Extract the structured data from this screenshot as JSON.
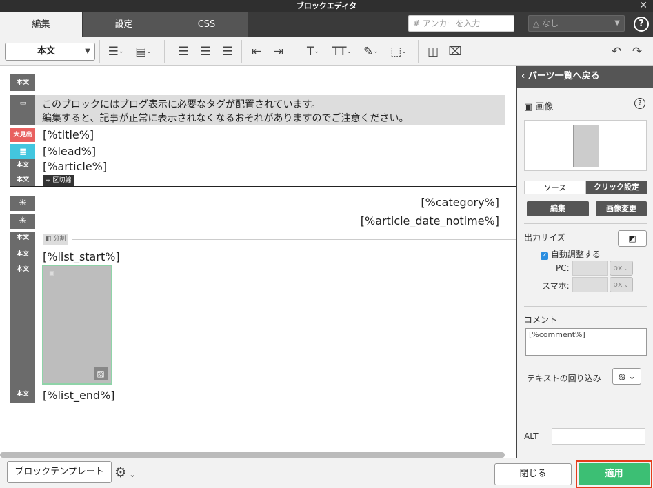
{
  "window": {
    "title": "ブロックエディタ",
    "close": "✕"
  },
  "tabs": [
    {
      "label": "編集"
    },
    {
      "label": "設定"
    },
    {
      "label": "CSS"
    }
  ],
  "anchor": {
    "placeholder": "# アンカーを入力"
  },
  "select_none": {
    "value": "なし"
  },
  "help": "?",
  "toolbar": {
    "format_value": "本文"
  },
  "editor": {
    "block_label": "本文",
    "heading_label": "大見出",
    "notice_line1": "このブロックにはブログ表示に必要なタグが配置されています。",
    "notice_line2": "編集すると、記事が正常に表示されなくなるおそれがありますのでご注意ください。",
    "title": "[%title%]",
    "lead": "[%lead%]",
    "article": "[%article%]",
    "divider_label": "区切線",
    "category": "[%category%]",
    "article_date": "[%article_date_notime%]",
    "split_label": "分割",
    "list_start": "[%list_start%]",
    "list_end": "[%list_end%]"
  },
  "panel": {
    "back": "パーツ一覧へ戻る",
    "image_label": "画像",
    "tabs": [
      "ソース",
      "クリック設定"
    ],
    "edit_button": "編集",
    "change_image_button": "画像変更",
    "output_size": "出力サイズ",
    "auto_adjust": "自動調整する",
    "pc_label": "PC:",
    "sp_label": "スマホ:",
    "unit": "px",
    "comment_label": "コメント",
    "comment_value": "[%comment%]",
    "wrap_label": "テキストの回り込み",
    "alt_label": "ALT"
  },
  "footer": {
    "template_button": "ブロックテンプレート",
    "close_button": "閉じる",
    "apply_button": "適用"
  },
  "colors": {
    "accent_green": "#3cbf74",
    "highlight_red": "#e53c1b",
    "heading_red": "#e8605f",
    "lead_cyan": "#43c6df"
  }
}
